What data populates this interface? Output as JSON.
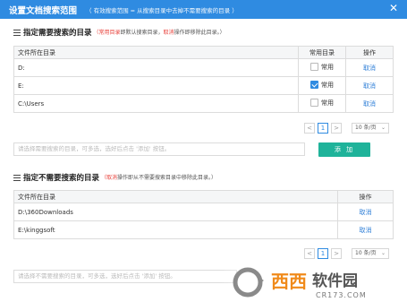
{
  "title": "设置文档搜索范围",
  "subtitle": "（ 有效搜索范围 = 从搜索目录中去掉不需要搜索的目录 ）",
  "close_glyph": "✕",
  "include": {
    "heading": "指定需要搜索的目录",
    "note_red1": "（常用目录",
    "note_mid": "即默认搜索目录，",
    "note_red2": "取消",
    "note_tail": "操作即移除此目录。）",
    "columns": [
      "文件所在目录",
      "常用目录",
      "操作"
    ],
    "rows": [
      {
        "path": "D:",
        "common_label": "常用",
        "checked": false,
        "action": "取消"
      },
      {
        "path": "E:",
        "common_label": "常用",
        "checked": true,
        "action": "取消"
      },
      {
        "path": "C:\\Users",
        "common_label": "常用",
        "checked": false,
        "action": "取消"
      }
    ],
    "pager": {
      "prev": "<",
      "page": "1",
      "next": ">",
      "size": "10 条/页"
    },
    "input_placeholder": "请选择需要搜索的目录，可多选，选好后点击 '添加' 按钮。",
    "add_button": "添 加"
  },
  "exclude": {
    "heading": "指定不需要搜索的目录",
    "note_red1": "（取消",
    "note_tail": "操作即从不需要搜索目录中移除此目录。）",
    "columns": [
      "文件所在目录",
      "操作"
    ],
    "rows": [
      {
        "path": "D:\\360Downloads",
        "action": "取消"
      },
      {
        "path": "E:\\kinggsoft",
        "action": "取消"
      }
    ],
    "pager": {
      "prev": "<",
      "page": "1",
      "next": ">",
      "size": "10 条/页"
    },
    "input_placeholder": "请选择不需要搜索的目录，可多选，选好后点击 '添加' 按钮。"
  },
  "watermark": {
    "brand": "西西软件园",
    "url": "CR173.COM"
  },
  "colors": {
    "accent": "#2f8be1",
    "red": "#e8403a",
    "green": "#1fb39a",
    "link": "#2f7fd7"
  }
}
